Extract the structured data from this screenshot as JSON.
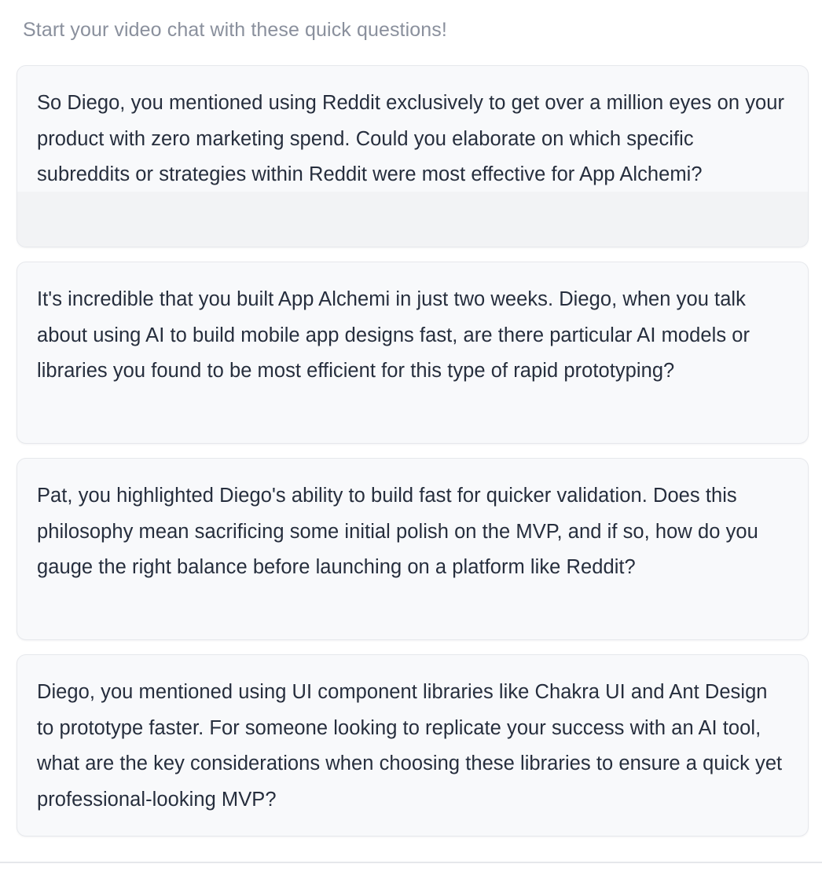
{
  "header": {
    "title": "Start your video chat with these quick questions!"
  },
  "questions": [
    {
      "text": "So Diego, you mentioned using Reddit exclusively to get over a million eyes on your product with zero marketing spend. Could you elaborate on which specific subreddits or strategies within Reddit were most effective for App Alchemi?"
    },
    {
      "text": "It's incredible that you built App Alchemi in just two weeks. Diego, when you talk about using AI to build mobile app designs fast, are there particular AI models or libraries you found to be most efficient for this type of rapid prototyping?"
    },
    {
      "text": "Pat, you highlighted Diego's ability to build fast for quicker validation. Does this philosophy mean sacrificing some initial polish on the MVP, and if so, how do you gauge the right balance before launching on a platform like Reddit?"
    },
    {
      "text": "Diego, you mentioned using UI component libraries like Chakra UI and Ant Design to prototype faster. For someone looking to replicate your success with an AI tool, what are the key considerations when choosing these libraries to ensure a quick yet professional-looking MVP?"
    }
  ]
}
